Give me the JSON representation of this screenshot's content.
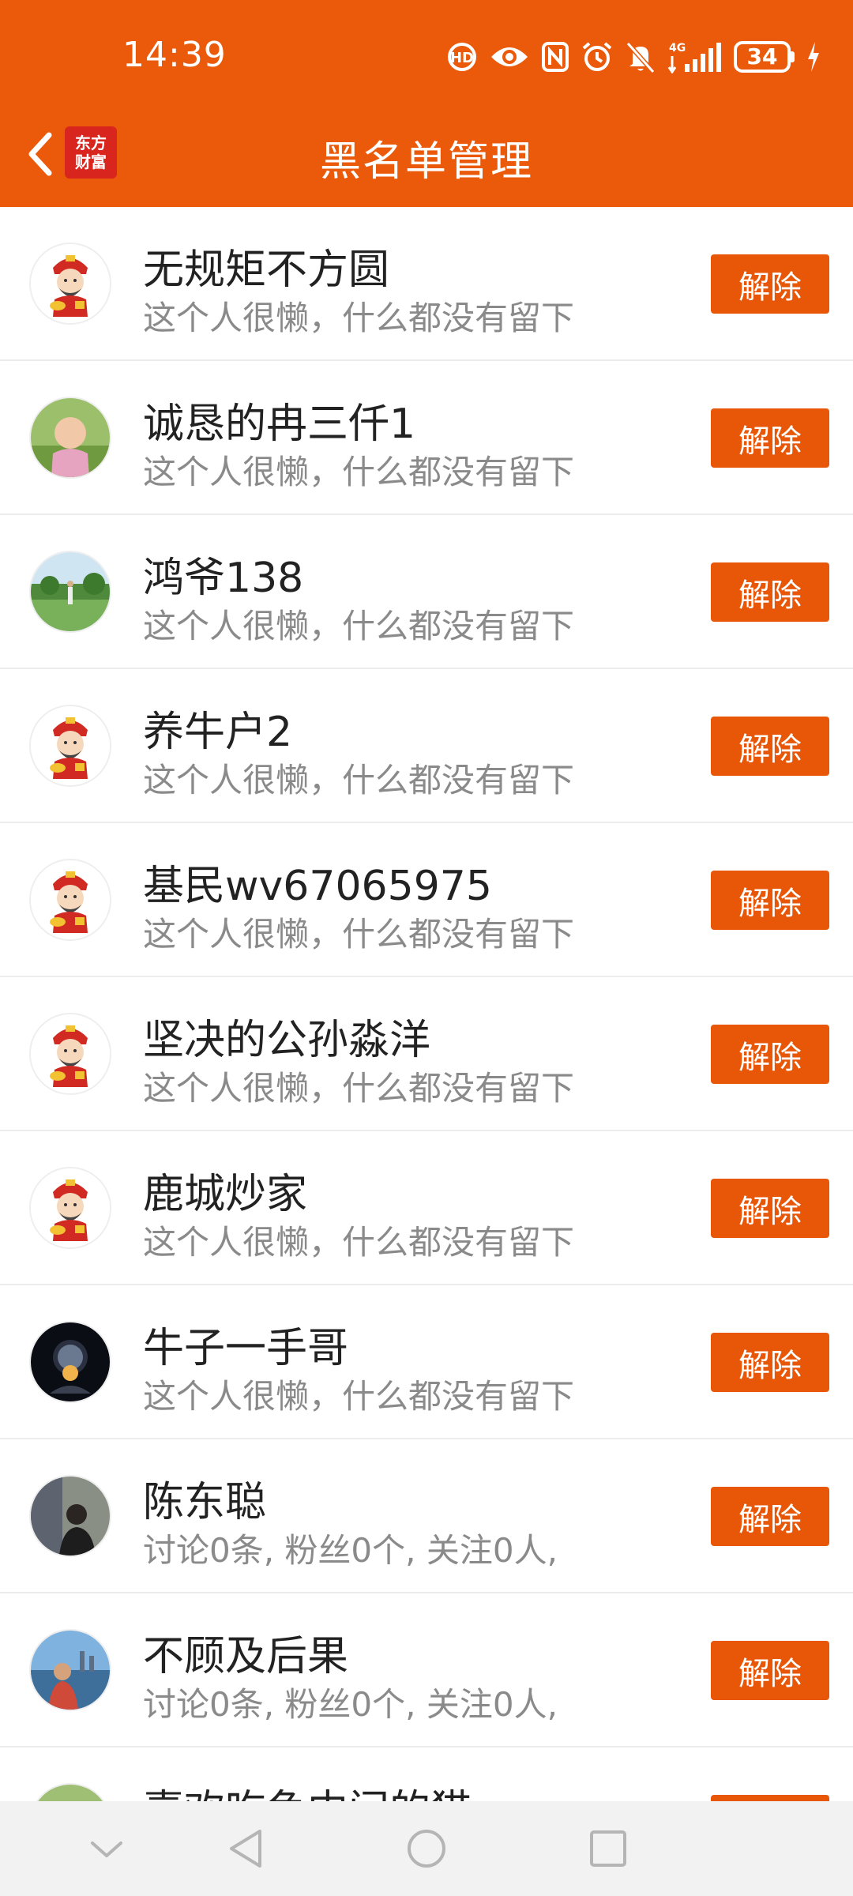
{
  "status_bar": {
    "time": "14:39",
    "battery": "34",
    "network": "4G",
    "icons": [
      "hd-call-icon",
      "eye-icon",
      "nfc-icon",
      "alarm-icon",
      "mute-icon",
      "signal-icon",
      "battery-icon",
      "charging-icon"
    ]
  },
  "header": {
    "title": "黑名单管理",
    "logo_line1": "东方",
    "logo_line2": "财富",
    "accent_color": "#ea5a0a"
  },
  "list": {
    "remove_label": "解除",
    "items": [
      {
        "name": "无规矩不方圆",
        "desc": "这个人很懒，什么都没有留下",
        "avatar": "fortune-god-avatar"
      },
      {
        "name": "诚恳的冉三仟1",
        "desc": "这个人很懒，什么都没有留下",
        "avatar": "baby-photo-avatar"
      },
      {
        "name": "鸿爷138",
        "desc": "这个人很懒，什么都没有留下",
        "avatar": "golf-photo-avatar"
      },
      {
        "name": "养牛户2",
        "desc": "这个人很懒，什么都没有留下",
        "avatar": "fortune-god-avatar"
      },
      {
        "name": "基民wv67065975",
        "desc": "这个人很懒，什么都没有留下",
        "avatar": "fortune-god-avatar"
      },
      {
        "name": "坚决的公孙淼洋",
        "desc": "这个人很懒，什么都没有留下",
        "avatar": "fortune-god-avatar"
      },
      {
        "name": "鹿城炒家",
        "desc": "这个人很懒，什么都没有留下",
        "avatar": "fortune-god-avatar"
      },
      {
        "name": "牛子一手哥",
        "desc": "这个人很懒，什么都没有留下",
        "avatar": "space-photo-avatar"
      },
      {
        "name": "陈东聪",
        "desc": "讨论0条, 粉丝0个, 关注0人,",
        "avatar": "person-photo-avatar"
      },
      {
        "name": "不顾及后果",
        "desc": "讨论0条, 粉丝0个, 关注0人,",
        "avatar": "harbor-photo-avatar"
      },
      {
        "name": "喜欢吃鱼中间的猫",
        "desc": "",
        "avatar": "nature-photo-avatar"
      }
    ]
  },
  "nav_bar": {
    "buttons": [
      "collapse-icon",
      "back-triangle-icon",
      "home-circle-icon",
      "recents-square-icon"
    ]
  }
}
